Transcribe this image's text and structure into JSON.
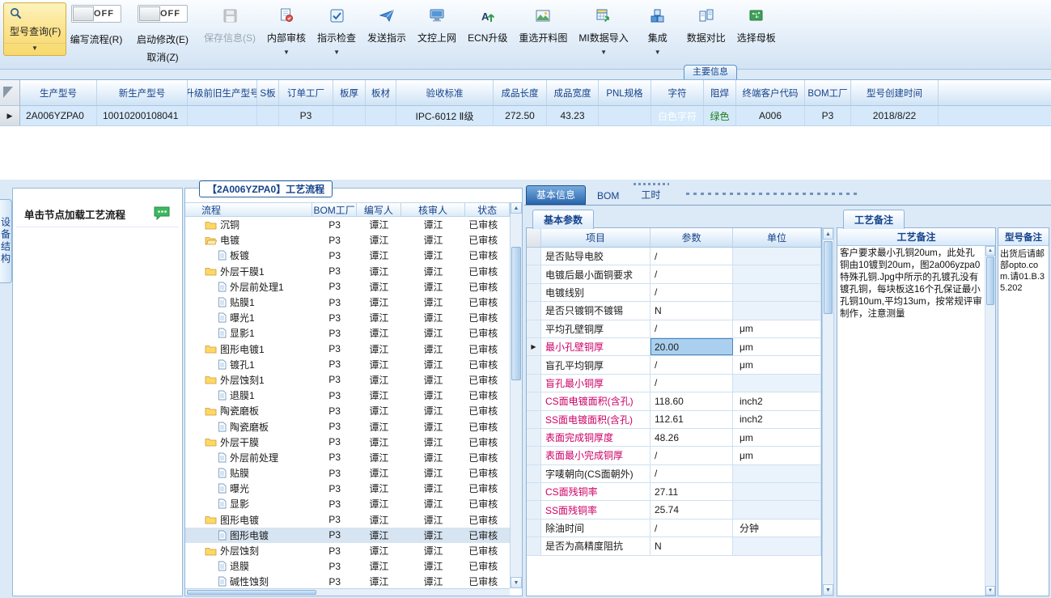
{
  "toolbar": {
    "model_query": {
      "label": "型号查询(F)"
    },
    "toggles": [
      {
        "state": "OFF",
        "label": "编写流程(R)",
        "sub_label": ""
      },
      {
        "state": "OFF",
        "label": "启动修改(E)",
        "sub_label": "取消(Z)"
      }
    ],
    "buttons": [
      {
        "label": "保存信息(S)",
        "icon": "save-icon",
        "disabled": true,
        "dropdown": false
      },
      {
        "label": "内部审核",
        "icon": "internal-audit-icon",
        "disabled": false,
        "dropdown": true
      },
      {
        "label": "指示检查",
        "icon": "instruction-check-icon",
        "disabled": false,
        "dropdown": true
      },
      {
        "label": "发送指示",
        "icon": "send-instruction-icon",
        "disabled": false,
        "dropdown": false
      },
      {
        "label": "文控上网",
        "icon": "doc-online-icon",
        "disabled": false,
        "dropdown": false
      },
      {
        "label": "ECN升级",
        "icon": "ecn-upgrade-icon",
        "disabled": false,
        "dropdown": false
      },
      {
        "label": "重选开料图",
        "icon": "cutting-diagram-icon",
        "disabled": false,
        "dropdown": false
      },
      {
        "label": "MI数据导入",
        "icon": "mi-import-icon",
        "disabled": false,
        "dropdown": true
      },
      {
        "label": "集成",
        "icon": "integration-icon",
        "disabled": false,
        "dropdown": true
      },
      {
        "label": "数据对比",
        "icon": "data-compare-icon",
        "disabled": false,
        "dropdown": false
      },
      {
        "label": "选择母板",
        "icon": "select-board-icon",
        "disabled": false,
        "dropdown": false
      }
    ]
  },
  "main_tab": {
    "label": "主要信息"
  },
  "model_grid": {
    "columns": [
      "生产型号",
      "新生产型号",
      "升级前旧生产型号",
      "S板",
      "订单工厂",
      "板厚",
      "板材",
      "验收标准",
      "成品长度",
      "成品宽度",
      "PNL规格",
      "字符",
      "阻焊",
      "终端客户代码",
      "BOM工厂",
      "型号创建时间"
    ],
    "row": [
      "2A006YZPA0",
      "10010200108041",
      "",
      "",
      "P3",
      "",
      "",
      "IPC-6012 Ⅱ级",
      "272.50",
      "43.23",
      "",
      "白色字符",
      "绿色",
      "A006",
      "P3",
      "2018/8/22"
    ]
  },
  "left_panel": {
    "vertical_tab": "设备结构",
    "hint": "单击节点加载工艺流程"
  },
  "flow_panel": {
    "title": "【2A006YZPA0】工艺流程",
    "columns": [
      "流程",
      "BOM工厂",
      "编写人",
      "核审人",
      "状态"
    ],
    "defaults": {
      "bom": "P3",
      "writer": "谭江",
      "auditor": "谭江",
      "status": "已审核",
      "selected": false
    },
    "rows": [
      {
        "name": "沉铜",
        "icon": "folder",
        "level": 1
      },
      {
        "name": "电镀",
        "icon": "folder-open",
        "level": 1
      },
      {
        "name": "板镀",
        "icon": "file",
        "level": 2
      },
      {
        "name": "外层干膜1",
        "icon": "folder",
        "level": 1
      },
      {
        "name": "外层前处理1",
        "icon": "file",
        "level": 2
      },
      {
        "name": "贴膜1",
        "icon": "file",
        "level": 2
      },
      {
        "name": "曝光1",
        "icon": "file",
        "level": 2
      },
      {
        "name": "显影1",
        "icon": "file",
        "level": 2
      },
      {
        "name": "图形电镀1",
        "icon": "folder",
        "level": 1
      },
      {
        "name": "镀孔1",
        "icon": "file",
        "level": 2
      },
      {
        "name": "外层蚀刻1",
        "icon": "folder",
        "level": 1
      },
      {
        "name": "退膜1",
        "icon": "file",
        "level": 2
      },
      {
        "name": "陶瓷磨板",
        "icon": "folder",
        "level": 1
      },
      {
        "name": "陶瓷磨板",
        "icon": "file",
        "level": 2
      },
      {
        "name": "外层干膜",
        "icon": "folder",
        "level": 1
      },
      {
        "name": "外层前处理",
        "icon": "file",
        "level": 2
      },
      {
        "name": "贴膜",
        "icon": "file",
        "level": 2
      },
      {
        "name": "曝光",
        "icon": "file",
        "level": 2
      },
      {
        "name": "显影",
        "icon": "file",
        "level": 2
      },
      {
        "name": "图形电镀",
        "icon": "folder",
        "level": 1
      },
      {
        "name": "图形电镀",
        "icon": "file",
        "level": 2,
        "selected": true
      },
      {
        "name": "外层蚀刻",
        "icon": "folder",
        "level": 1
      },
      {
        "name": "退膜",
        "icon": "file",
        "level": 2
      },
      {
        "name": "碱性蚀刻",
        "icon": "file",
        "level": 2
      }
    ]
  },
  "right_panel": {
    "tabs": [
      {
        "label": "基本信息",
        "selected": true
      },
      {
        "label": "BOM",
        "selected": false
      },
      {
        "label": "工时",
        "selected": false
      }
    ],
    "params": {
      "tab": "基本参数",
      "columns": [
        "项目",
        "参数",
        "单位"
      ],
      "rows": [
        {
          "item": "是否贴导电胶",
          "value": "/",
          "unit": "",
          "pink": false,
          "selected": false
        },
        {
          "item": "电镀后最小面铜要求",
          "value": "/",
          "unit": "",
          "pink": false,
          "selected": false
        },
        {
          "item": "电镀线别",
          "value": "/",
          "unit": "",
          "pink": false,
          "selected": false
        },
        {
          "item": "是否只镀铜不镀锡",
          "value": "N",
          "unit": "",
          "pink": false,
          "selected": false
        },
        {
          "item": "平均孔壁铜厚",
          "value": "/",
          "unit": "μm",
          "pink": false,
          "selected": false
        },
        {
          "item": "最小孔壁铜厚",
          "value": "20.00",
          "unit": "μm",
          "pink": true,
          "selected": true
        },
        {
          "item": "盲孔平均铜厚",
          "value": "/",
          "unit": "μm",
          "pink": false,
          "selected": false
        },
        {
          "item": "盲孔最小铜厚",
          "value": "/",
          "unit": "",
          "pink": true,
          "selected": false
        },
        {
          "item": "CS面电镀面积(含孔)",
          "value": "118.60",
          "unit": "inch2",
          "pink": true,
          "selected": false
        },
        {
          "item": "SS面电镀面积(含孔)",
          "value": "112.61",
          "unit": "inch2",
          "pink": true,
          "selected": false
        },
        {
          "item": "表面完成铜厚度",
          "value": "48.26",
          "unit": "μm",
          "pink": true,
          "selected": false
        },
        {
          "item": "表面最小完成铜厚",
          "value": "/",
          "unit": "μm",
          "pink": true,
          "selected": false
        },
        {
          "item": "字唛朝向(CS面朝外)",
          "value": "/",
          "unit": "",
          "pink": false,
          "selected": false
        },
        {
          "item": "CS面残铜率",
          "value": "27.11",
          "unit": "",
          "pink": true,
          "selected": false
        },
        {
          "item": "SS面残铜率",
          "value": "25.74",
          "unit": "",
          "pink": true,
          "selected": false
        },
        {
          "item": "除油时间",
          "value": "/",
          "unit": "分钟",
          "pink": false,
          "selected": false
        },
        {
          "item": "是否为高精度阻抗",
          "value": "N",
          "unit": "",
          "pink": false,
          "selected": false
        }
      ]
    },
    "process_remark": {
      "tab": "工艺备注",
      "header": "工艺备注",
      "text": "客户要求最小孔铜20um，此处孔铜由10镀到20um，图2a006yzpa0特殊孔铜.Jpg中所示的孔镀孔没有镀孔铜，每块板这16个孔保证最小孔铜10um,平均13um，按常规评审制作，注意测量"
    },
    "model_remark": {
      "header": "型号备注",
      "text": "出货后请邮部opto.com.请01.B.35.202"
    }
  }
}
